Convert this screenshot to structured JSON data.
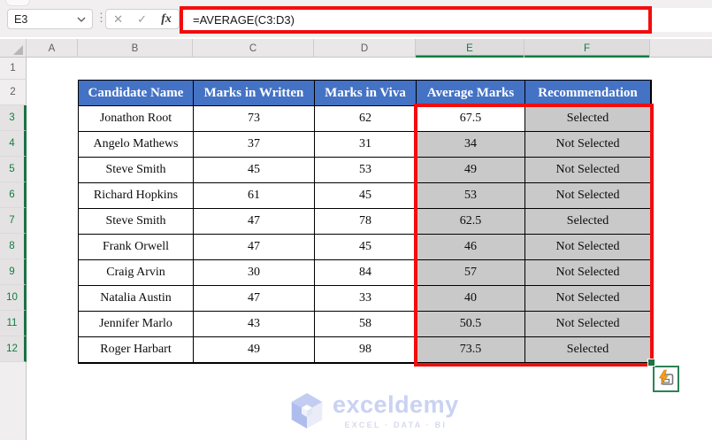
{
  "formula_bar": {
    "name_box_value": "E3",
    "cancel_label": "✕",
    "enter_label": "✓",
    "fx_label": "fx",
    "formula": "=AVERAGE(C3:D3)"
  },
  "sheet": {
    "column_headers": [
      "A",
      "B",
      "C",
      "D",
      "E",
      "F"
    ],
    "highlighted_columns": [
      "E",
      "F"
    ],
    "row_headers": [
      "1",
      "2",
      "3",
      "4",
      "5",
      "6",
      "7",
      "8",
      "9",
      "10",
      "11",
      "12"
    ],
    "highlighted_rows": [
      "3",
      "4",
      "5",
      "6",
      "7",
      "8",
      "9",
      "10",
      "11",
      "12"
    ],
    "active_cell": "E3"
  },
  "table": {
    "headers": [
      "Candidate Name",
      "Marks in Written",
      "Marks in Viva",
      "Average Marks",
      "Recommendation"
    ],
    "rows": [
      {
        "candidate": "Jonathon Root",
        "written": "73",
        "viva": "62",
        "average": "67.5",
        "recommendation": "Selected"
      },
      {
        "candidate": "Angelo Mathews",
        "written": "37",
        "viva": "31",
        "average": "34",
        "recommendation": "Not Selected"
      },
      {
        "candidate": "Steve Smith",
        "written": "45",
        "viva": "53",
        "average": "49",
        "recommendation": "Not Selected"
      },
      {
        "candidate": "Richard Hopkins",
        "written": "61",
        "viva": "45",
        "average": "53",
        "recommendation": "Not Selected"
      },
      {
        "candidate": "Steve Smith",
        "written": "47",
        "viva": "78",
        "average": "62.5",
        "recommendation": "Selected"
      },
      {
        "candidate": "Frank Orwell",
        "written": "47",
        "viva": "45",
        "average": "46",
        "recommendation": "Not Selected"
      },
      {
        "candidate": "Craig Arvin",
        "written": "30",
        "viva": "84",
        "average": "57",
        "recommendation": "Not Selected"
      },
      {
        "candidate": "Natalia Austin",
        "written": "47",
        "viva": "33",
        "average": "40",
        "recommendation": "Not Selected"
      },
      {
        "candidate": "Jennifer Marlo",
        "written": "43",
        "viva": "58",
        "average": "50.5",
        "recommendation": "Not Selected"
      },
      {
        "candidate": "Roger Harbart",
        "written": "49",
        "viva": "98",
        "average": "73.5",
        "recommendation": "Selected"
      }
    ]
  },
  "watermark": {
    "brand": "exceldemy",
    "tagline": "EXCEL · DATA · BI"
  },
  "colors": {
    "table_header_fill": "#4472C4",
    "selection_fill": "#C9C9C9",
    "annotation_red": "#F20D0D",
    "excel_green": "#107C41",
    "header_strip": "#E9E7E8"
  }
}
